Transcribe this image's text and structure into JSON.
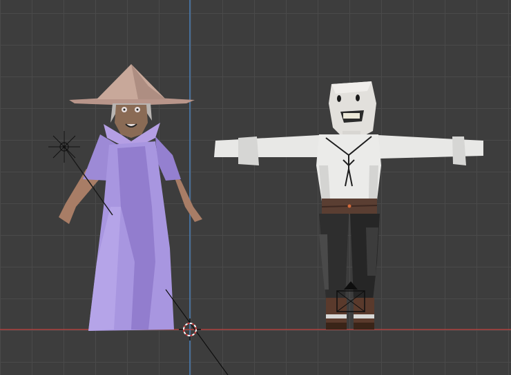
{
  "viewport": {
    "background": "#3d3d3d",
    "grid_color": "#4a4a4a",
    "x_axis_color": "#b0423f",
    "z_axis_color": "#4a7fb8"
  },
  "objects": [
    {
      "name": "Wizard",
      "description_icon": "wizard-character-icon",
      "robe_color": "#9a86d8",
      "hat_color": "#c8a89a"
    },
    {
      "name": "Pirate",
      "description_icon": "pirate-character-icon",
      "shirt_color": "#e6e6e6",
      "pants_color": "#2c2c2c"
    }
  ],
  "gizmos": [
    "light-icon",
    "camera-icon",
    "3d-cursor-icon"
  ]
}
